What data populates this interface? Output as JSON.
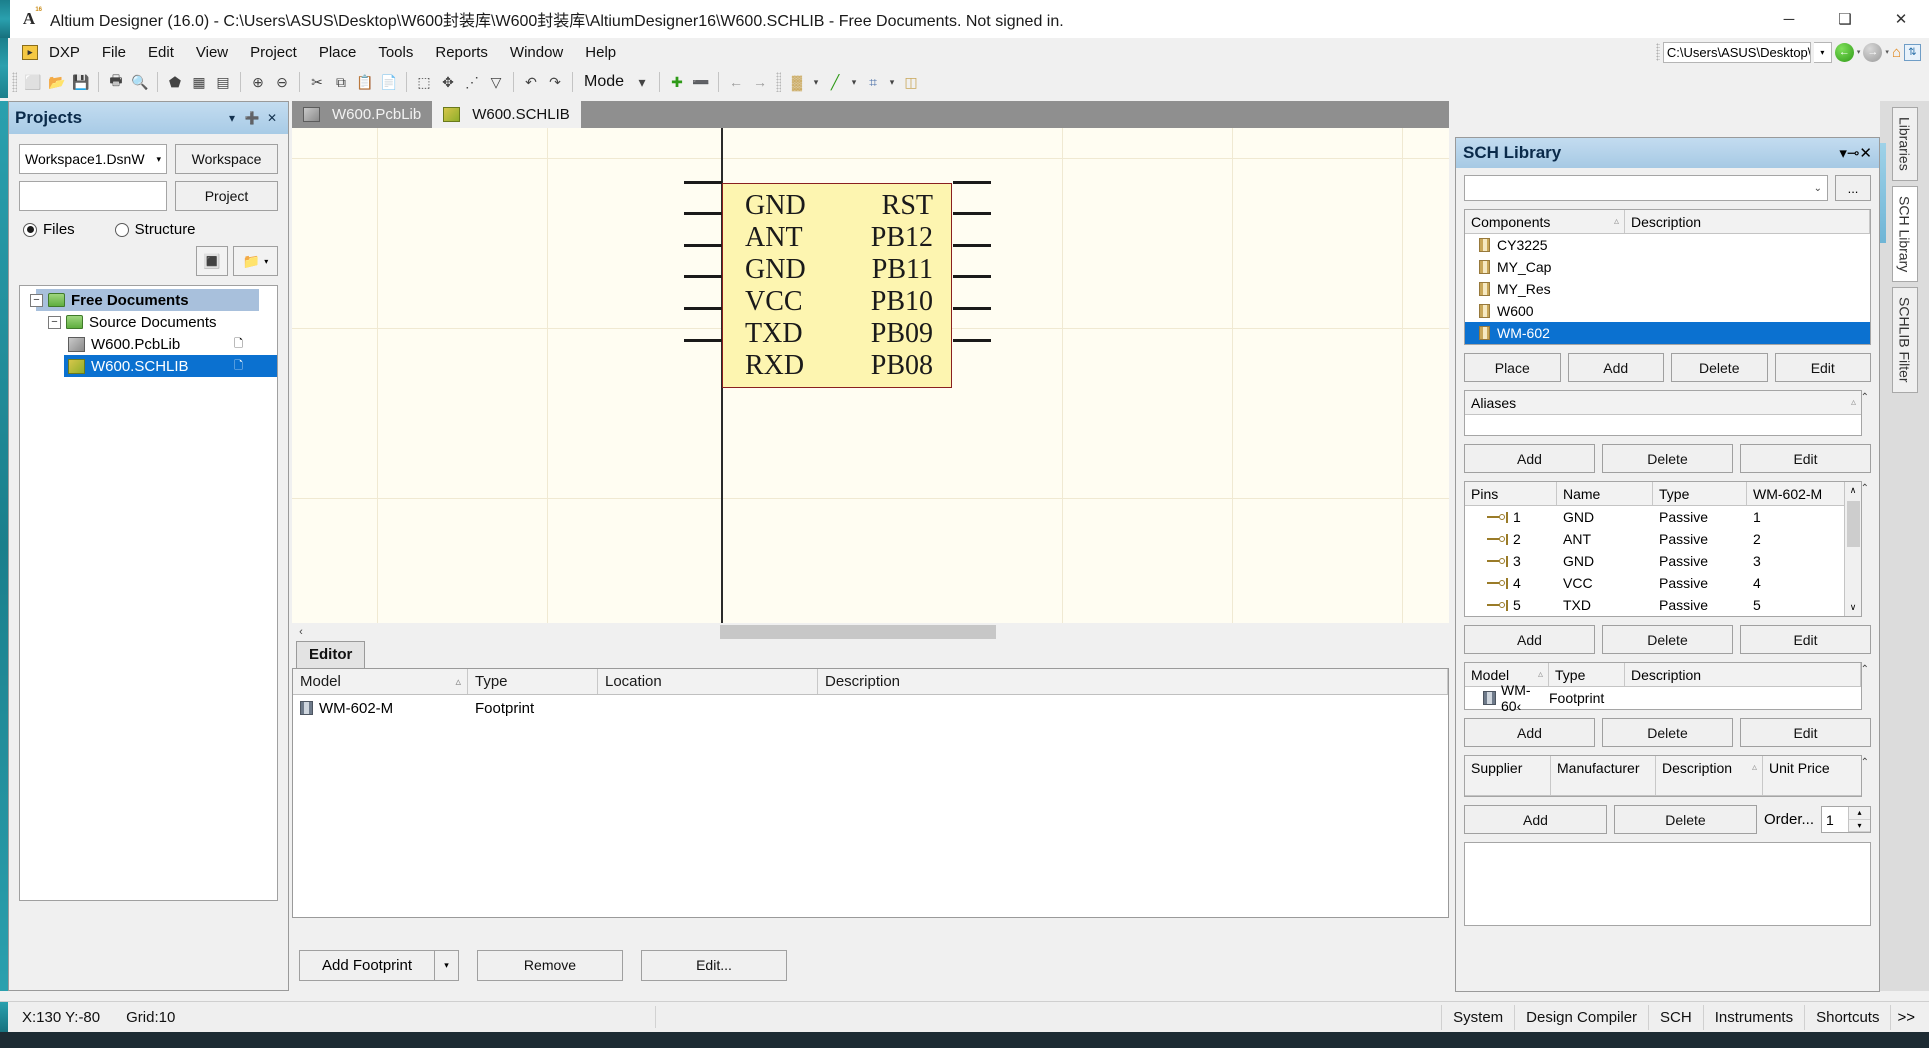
{
  "window": {
    "title": "Altium Designer (16.0) - C:\\Users\\ASUS\\Desktop\\W600封装库\\W600封装库\\AltiumDesigner16\\W600.SCHLIB - Free Documents. Not signed in.",
    "app_icon": "altium-a-icon",
    "minimize": "─",
    "maximize": "❑",
    "close": "✕"
  },
  "menubar": {
    "dxp_badge": "▸",
    "items": [
      {
        "label": "DXP"
      },
      {
        "label": "File"
      },
      {
        "label": "Edit"
      },
      {
        "label": "View"
      },
      {
        "label": "Project"
      },
      {
        "label": "Place"
      },
      {
        "label": "Tools"
      },
      {
        "label": "Reports"
      },
      {
        "label": "Window"
      },
      {
        "label": "Help"
      }
    ],
    "address_value": "C:\\Users\\ASUS\\Desktop\\",
    "dropdown_caret": "▾"
  },
  "toolbar": {
    "mode_label": "Mode",
    "mode_caret": "▾",
    "buttons": [
      {
        "name": "new-document-icon",
        "glyph": "⬜"
      },
      {
        "name": "open-document-icon",
        "glyph": "📂"
      },
      {
        "name": "save-icon",
        "glyph": "💾"
      },
      {
        "name": "print-icon",
        "glyph": "🖶"
      },
      {
        "name": "print-preview-icon",
        "glyph": "🔍"
      },
      {
        "name": "open-device-view-icon",
        "glyph": "⬟"
      },
      {
        "name": "pcb-board-icon",
        "glyph": "▦"
      },
      {
        "name": "library-icon",
        "glyph": "▤"
      },
      {
        "name": "zoom-in-icon",
        "glyph": "⊕"
      },
      {
        "name": "zoom-out-icon",
        "glyph": "⊖"
      },
      {
        "name": "cut-icon",
        "glyph": "✂"
      },
      {
        "name": "copy-icon",
        "glyph": "⧉"
      },
      {
        "name": "paste-icon",
        "glyph": "📋"
      },
      {
        "name": "rubber-stamp-icon",
        "glyph": "📄"
      },
      {
        "name": "select-area-icon",
        "glyph": "⬚"
      },
      {
        "name": "move-selection-icon",
        "glyph": "✥"
      },
      {
        "name": "wiring-icon",
        "glyph": "⋰"
      },
      {
        "name": "clear-filter-icon",
        "glyph": "▽"
      },
      {
        "name": "undo-icon",
        "glyph": "↶"
      },
      {
        "name": "redo-icon",
        "glyph": "↷"
      },
      {
        "name": "add-part-icon",
        "glyph": "✚"
      },
      {
        "name": "remove-part-icon",
        "glyph": "➖"
      },
      {
        "name": "previous-part-icon",
        "glyph": "←"
      },
      {
        "name": "next-part-icon",
        "glyph": "→"
      },
      {
        "name": "place-pin-icon",
        "glyph": "▓"
      },
      {
        "name": "place-line-icon",
        "glyph": "╱"
      },
      {
        "name": "grid-icon",
        "glyph": "⌗"
      },
      {
        "name": "component-icon",
        "glyph": "◫"
      }
    ],
    "split_caret": "▾"
  },
  "projects_panel": {
    "title": "Projects",
    "collapse_icon": "▾",
    "pin_icon": "➕",
    "close_icon": "✕",
    "workspace_value": "Workspace1.DsnW",
    "workspace_caret": "▾",
    "project_value": "",
    "workspace_button": "Workspace",
    "project_button": "Project",
    "view_modes": [
      {
        "label": "Files",
        "selected": true
      },
      {
        "label": "Structure",
        "selected": false
      }
    ],
    "toolbar_icons": [
      {
        "name": "compile-icon",
        "glyph": "🔳"
      },
      {
        "name": "open-project-icon",
        "glyph": "📁"
      }
    ],
    "split_caret": "▾",
    "tree": [
      {
        "label": "Free Documents",
        "level": 0,
        "expander": "−",
        "icon": "folder-icon",
        "highlight": "band",
        "doc_icon": ""
      },
      {
        "label": "Source Documents",
        "level": 1,
        "expander": "−",
        "icon": "folder-icon",
        "highlight": "none",
        "doc_icon": ""
      },
      {
        "label": "W600.PcbLib",
        "level": 2,
        "expander": "",
        "icon": "pcblib-icon",
        "highlight": "none",
        "doc_icon": "🗋"
      },
      {
        "label": "W600.SCHLIB",
        "level": 2,
        "expander": "",
        "icon": "schlib-icon",
        "highlight": "selected",
        "doc_icon": "🗋"
      }
    ]
  },
  "document_tabs": [
    {
      "label": "W600.PcbLib",
      "icon": "pcblib-icon",
      "active": false
    },
    {
      "label": "W600.SCHLIB",
      "icon": "schlib-icon",
      "active": true
    }
  ],
  "schematic": {
    "left_pins": [
      "GND",
      "ANT",
      "GND",
      "VCC",
      "TXD",
      "RXD"
    ],
    "right_pins": [
      "RST",
      "PB12",
      "PB11",
      "PB10",
      "PB09",
      "PB08"
    ],
    "body_color": "#fdf5b0",
    "border_color": "#8a2020",
    "background": "#fffdf2",
    "grid_color": "#f0e9d2",
    "scroll_left_arrow": "‹"
  },
  "editor_pane": {
    "tab_label": "Editor",
    "columns": [
      "Model",
      "Type",
      "Location",
      "Description"
    ],
    "sort_mark": "▵",
    "rows": [
      {
        "model": "WM-602-M",
        "type": "Footprint",
        "location": "",
        "description": ""
      }
    ],
    "buttons": {
      "add_footprint": "Add Footprint",
      "add_footprint_caret": "▾",
      "remove": "Remove",
      "edit": "Edit..."
    }
  },
  "sch_library_panel": {
    "title": "SCH Library",
    "collapse_icon": "▾",
    "pin_icon": "⊸",
    "close_icon": "✕",
    "search_value": "",
    "search_caret": "⌄",
    "browse_button": "...",
    "components": {
      "columns": [
        "Components",
        "Description"
      ],
      "sort_mark": "▵",
      "items": [
        {
          "name": "CY3225",
          "selected": false
        },
        {
          "name": "MY_Cap",
          "selected": false
        },
        {
          "name": "MY_Res",
          "selected": false
        },
        {
          "name": "W600",
          "selected": false
        },
        {
          "name": "WM-602",
          "selected": true
        }
      ],
      "buttons": [
        "Place",
        "Add",
        "Delete",
        "Edit"
      ]
    },
    "aliases": {
      "header": "Aliases",
      "sort_mark": "▵",
      "items": [],
      "buttons": [
        "Add",
        "Delete",
        "Edit"
      ],
      "scroll_up": "⌃"
    },
    "pins": {
      "columns": [
        "Pins",
        "Name",
        "Type",
        "WM-602-M"
      ],
      "rows": [
        {
          "pin": "1",
          "name": "GND",
          "type": "Passive",
          "designator": "1"
        },
        {
          "pin": "2",
          "name": "ANT",
          "type": "Passive",
          "designator": "2"
        },
        {
          "pin": "3",
          "name": "GND",
          "type": "Passive",
          "designator": "3"
        },
        {
          "pin": "4",
          "name": "VCC",
          "type": "Passive",
          "designator": "4"
        },
        {
          "pin": "5",
          "name": "TXD",
          "type": "Passive",
          "designator": "5"
        }
      ],
      "scroll_up": "∧",
      "scroll_down": "∨",
      "buttons": [
        "Add",
        "Delete",
        "Edit"
      ]
    },
    "models": {
      "columns": [
        "Model",
        "Type",
        "Description"
      ],
      "sort_mark": "▵",
      "rows": [
        {
          "model": "WM-60‹",
          "type": "Footprint",
          "description": ""
        }
      ],
      "buttons": [
        "Add",
        "Delete",
        "Edit"
      ],
      "scroll_up": "⌃"
    },
    "supplier": {
      "columns": [
        "Supplier",
        "Manufacturer",
        "Description",
        "Unit Price"
      ],
      "sort_mark": "▵",
      "rows": [],
      "add_button": "Add",
      "delete_button": "Delete",
      "order_label": "Order...",
      "quantity": "1",
      "spin_up": "▴",
      "spin_down": "▾",
      "scroll_up": "⌃"
    }
  },
  "right_vertical_tabs": [
    {
      "label": "Libraries",
      "active": false
    },
    {
      "label": "SCH Library",
      "active": true
    },
    {
      "label": "SCHLIB Filter",
      "active": false
    }
  ],
  "statusbar": {
    "coordinates": "X:130 Y:-80",
    "grid": "Grid:10",
    "panel_buttons": [
      "System",
      "Design Compiler",
      "SCH",
      "Instruments",
      "Shortcuts"
    ],
    "more": ">>"
  }
}
